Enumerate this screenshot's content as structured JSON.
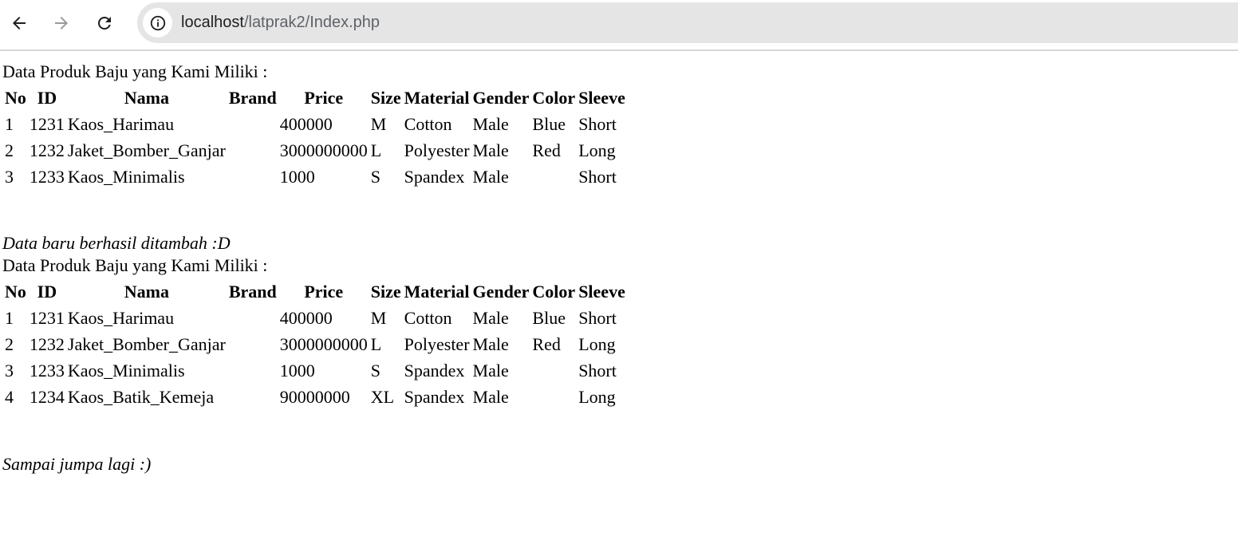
{
  "browser": {
    "url_host": "localhost",
    "url_path": "/latprak2/Index.php"
  },
  "page": {
    "heading1": "Data Produk Baju yang Kami Miliki :",
    "table1": {
      "headers": [
        "No",
        "ID",
        "Nama",
        "Brand",
        "Price",
        "Size",
        "Material",
        "Gender",
        "Color",
        "Sleeve"
      ],
      "rows": [
        [
          "1",
          "1231",
          "Kaos_Harimau",
          "",
          "400000",
          "M",
          "Cotton",
          "Male",
          "Blue",
          "Short"
        ],
        [
          "2",
          "1232",
          "Jaket_Bomber_Ganjar",
          "",
          "3000000000",
          "L",
          "Polyester",
          "Male",
          "Red",
          "Long"
        ],
        [
          "3",
          "1233",
          "Kaos_Minimalis",
          "",
          "1000",
          "S",
          "Spandex",
          "Male",
          "",
          "Short"
        ]
      ]
    },
    "success_message": "Data baru berhasil ditambah :D",
    "heading2": "Data Produk Baju yang Kami Miliki :",
    "table2": {
      "headers": [
        "No",
        "ID",
        "Nama",
        "Brand",
        "Price",
        "Size",
        "Material",
        "Gender",
        "Color",
        "Sleeve"
      ],
      "rows": [
        [
          "1",
          "1231",
          "Kaos_Harimau",
          "",
          "400000",
          "M",
          "Cotton",
          "Male",
          "Blue",
          "Short"
        ],
        [
          "2",
          "1232",
          "Jaket_Bomber_Ganjar",
          "",
          "3000000000",
          "L",
          "Polyester",
          "Male",
          "Red",
          "Long"
        ],
        [
          "3",
          "1233",
          "Kaos_Minimalis",
          "",
          "1000",
          "S",
          "Spandex",
          "Male",
          "",
          "Short"
        ],
        [
          "4",
          "1234",
          "Kaos_Batik_Kemeja",
          "",
          "90000000",
          "XL",
          "Spandex",
          "Male",
          "",
          "Long"
        ]
      ]
    },
    "farewell": "Sampai jumpa lagi :)"
  }
}
